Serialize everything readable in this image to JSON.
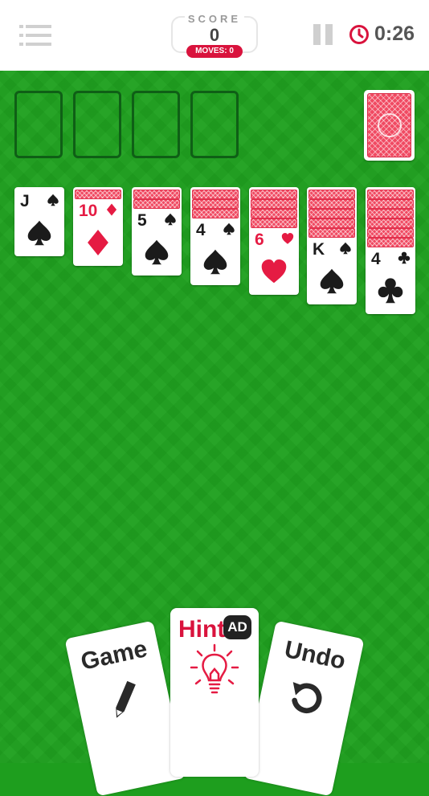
{
  "header": {
    "score_label": "SCORE",
    "score_value": "0",
    "moves_label": "MOVES:",
    "moves_value": "0",
    "timer": "0:26"
  },
  "colors": {
    "felt": "#1fa01f",
    "accent": "#d9133d",
    "card_back": "#f04a62"
  },
  "tableau": [
    {
      "rank": "J",
      "suit": "spade",
      "color": "black",
      "face_down": 0
    },
    {
      "rank": "10",
      "suit": "diamond",
      "color": "red",
      "face_down": 1
    },
    {
      "rank": "5",
      "suit": "spade",
      "color": "black",
      "face_down": 2
    },
    {
      "rank": "4",
      "suit": "spade",
      "color": "black",
      "face_down": 3
    },
    {
      "rank": "6",
      "suit": "heart",
      "color": "red",
      "face_down": 4
    },
    {
      "rank": "K",
      "suit": "spade",
      "color": "black",
      "face_down": 5
    },
    {
      "rank": "4",
      "suit": "club",
      "color": "black",
      "face_down": 6
    }
  ],
  "buttons": {
    "game_label": "Game",
    "hint_label": "Hint",
    "ad_label": "AD",
    "undo_label": "Undo"
  },
  "icons": {
    "menu": "menu-icon",
    "pause": "pause-icon",
    "timer": "clock-icon",
    "game": "pencil-icon",
    "hint": "lightbulb-icon",
    "undo": "undo-arrow-icon"
  }
}
